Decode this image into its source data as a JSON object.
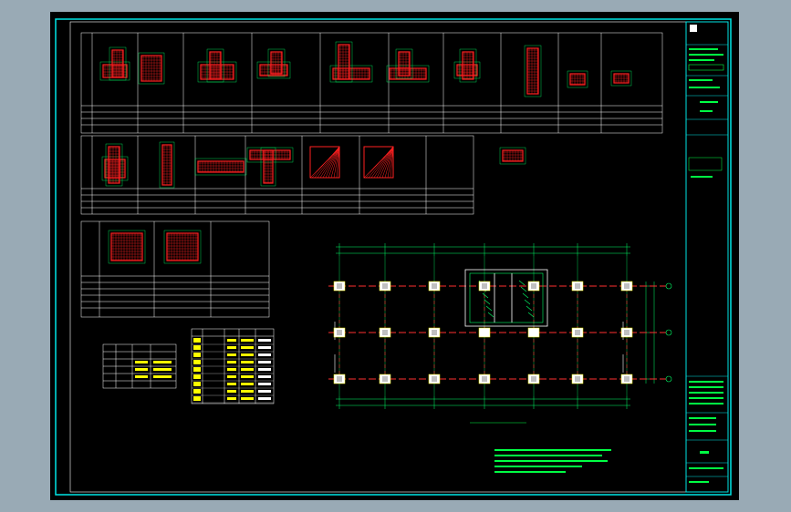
{
  "drawing": {
    "legend_title": "",
    "plan_title": "",
    "notes_heading": "",
    "notes": [
      "",
      "",
      ""
    ]
  },
  "title_block": {
    "sheet_label": ""
  },
  "colors": {
    "background": "#000000",
    "frame": "#00e5e5",
    "line": "#ffffff",
    "rebar": "#ff2020",
    "grid": "#ff3030",
    "dimension": "#00ff66",
    "column": "#ffff00",
    "text_green": "#00ff44"
  },
  "column_details": {
    "row1_count": 10,
    "row2_count": 7,
    "row3_count": 2
  },
  "plan": {
    "axes_horizontal": 3,
    "columns_per_row": 7
  }
}
